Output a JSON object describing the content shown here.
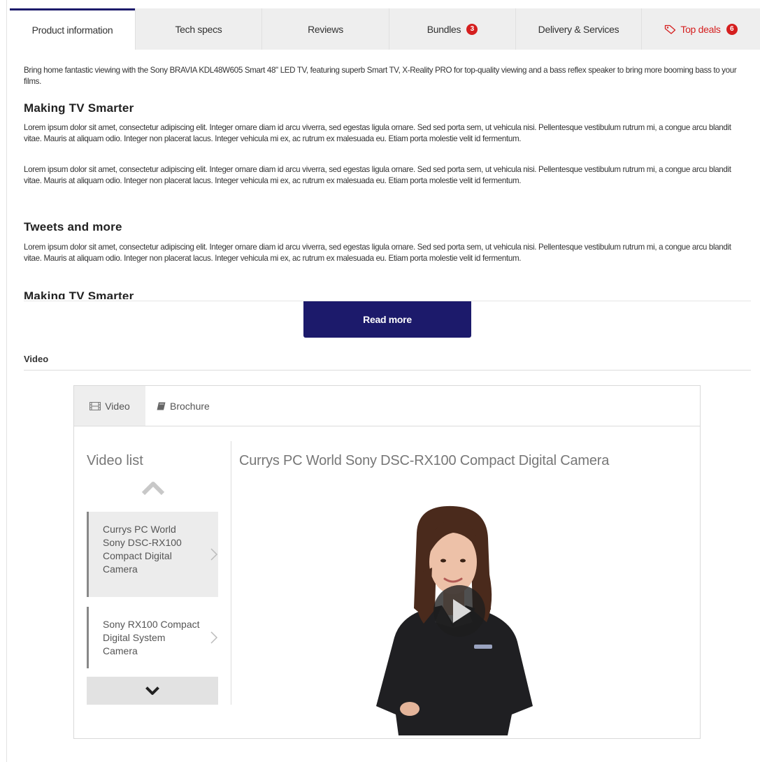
{
  "tabs": [
    {
      "label": "Product information",
      "active": true
    },
    {
      "label": "Tech specs"
    },
    {
      "label": "Reviews"
    },
    {
      "label": "Bundles",
      "badge": "3"
    },
    {
      "label": "Delivery & Services"
    },
    {
      "label": "Top deals",
      "badge": "6",
      "icon": "tag-icon"
    }
  ],
  "content": {
    "intro": "Bring home fantastic viewing with the Sony BRAVIA KDL48W605 Smart 48\" LED TV, featuring superb Smart TV, X-Reality PRO for top-quality viewing and a bass reflex speaker to bring more booming bass to your films.",
    "heading_1": "Making TV Smarter",
    "para_1": "Lorem ipsum dolor sit amet, consectetur adipiscing elit. Integer ornare diam id arcu viverra, sed egestas ligula ornare. Sed sed porta sem, ut vehicula nisi. Pellentesque vestibulum rutrum mi, a congue arcu blandit vitae. Mauris at aliquam odio. Integer non placerat lacus. Integer vehicula mi ex, ac rutrum ex malesuada eu. Etiam porta molestie velit id fermentum.",
    "para_2": "Lorem ipsum dolor sit amet, consectetur adipiscing elit. Integer ornare diam id arcu viverra, sed egestas ligula ornare. Sed sed porta sem, ut vehicula nisi. Pellentesque vestibulum rutrum mi, a congue arcu blandit vitae. Mauris at aliquam odio. Integer non placerat lacus. Integer vehicula mi ex, ac rutrum ex malesuada eu. Etiam porta molestie velit id fermentum.",
    "heading_2": "Tweets and more",
    "para_3": "Lorem ipsum dolor sit amet, consectetur adipiscing elit. Integer ornare diam id arcu viverra, sed egestas ligula ornare. Sed sed porta sem, ut vehicula nisi. Pellentesque vestibulum rutrum mi, a congue arcu blandit vitae. Mauris at aliquam odio. Integer non placerat lacus. Integer vehicula mi ex, ac rutrum ex malesuada eu. Etiam porta molestie velit id fermentum.",
    "heading_3": "Making TV Smarter"
  },
  "read_more_label": "Read more",
  "video_section": {
    "heading": "Video",
    "widget_tabs": [
      {
        "label": "Video",
        "icon": "film-icon",
        "active": true
      },
      {
        "label": "Brochure",
        "icon": "book-icon"
      }
    ],
    "list_title": "Video list",
    "items": [
      {
        "title": "Currys PC World Sony DSC-RX100 Compact Digital Camera",
        "active": true
      },
      {
        "title": "Sony RX100 Compact Digital System Camera"
      }
    ],
    "current_video_title": "Currys PC World Sony DSC-RX100 Compact Digital Camera"
  },
  "colors": {
    "brand_navy": "#1c1a6b",
    "badge_red": "#d51f1f",
    "tab_bg": "#eeeeee"
  }
}
